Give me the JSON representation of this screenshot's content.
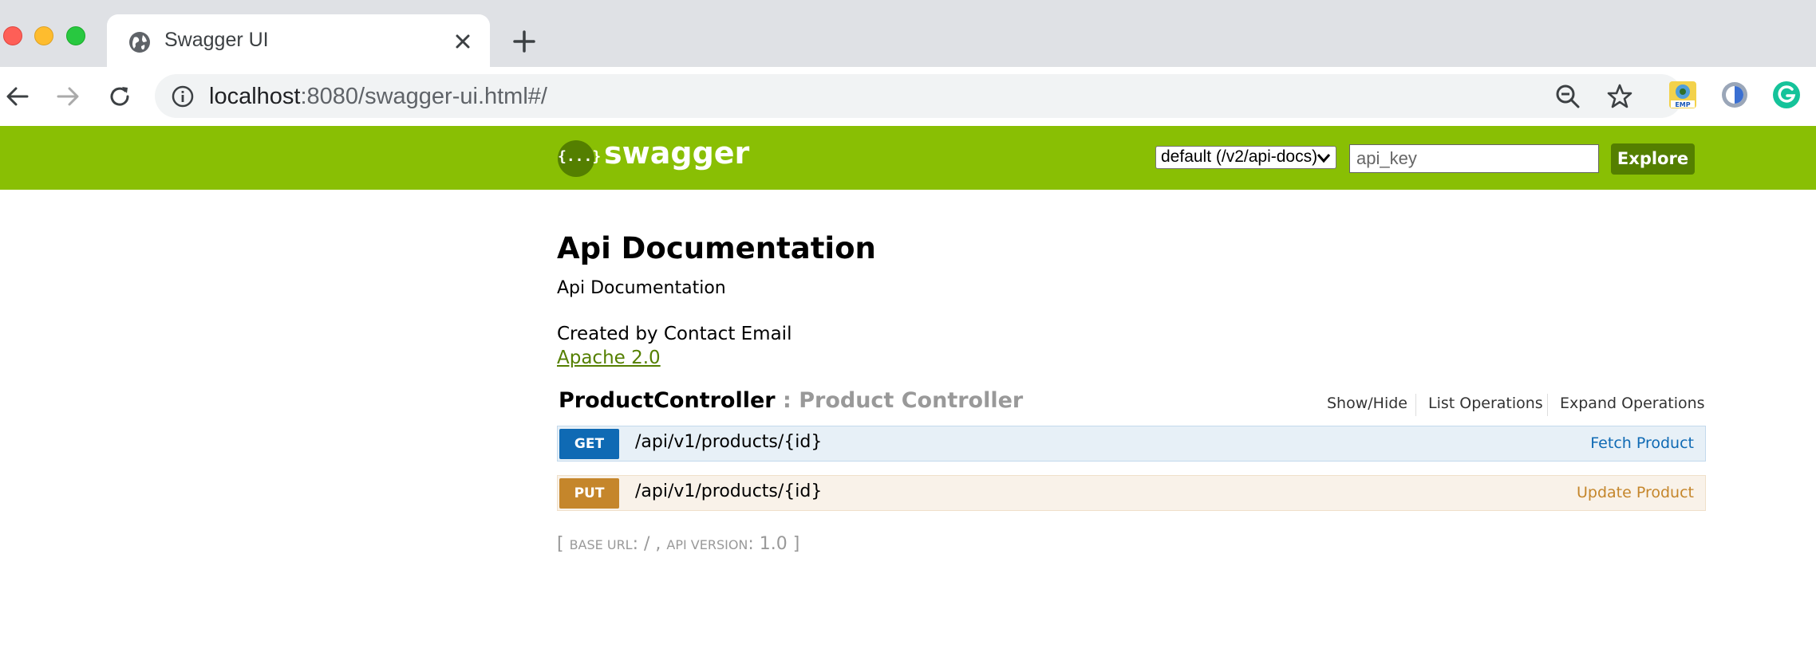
{
  "browser": {
    "tab_title": "Swagger UI",
    "url_host": "localhost",
    "url_rest": ":8080/swagger-ui.html#/",
    "extensions": [
      "emp-extension-icon",
      "shield-extension-icon",
      "grammarly-icon"
    ]
  },
  "swagger": {
    "brand": "swagger",
    "logo_glyph": "{...}",
    "spec_select": "default (/v2/api-docs)",
    "api_key_placeholder": "api_key",
    "explore_label": "Explore",
    "colors": {
      "header_bg": "#89bf04",
      "explore_bg": "#547f00",
      "get": "#0f6ab4",
      "put": "#c5862b"
    }
  },
  "info": {
    "title": "Api Documentation",
    "description": "Api Documentation",
    "contact": "Created by Contact Email",
    "license": "Apache 2.0"
  },
  "resource": {
    "name": "ProductController",
    "separator": " : ",
    "description": "Product Controller",
    "options": [
      "Show/Hide",
      "List Operations",
      "Expand Operations"
    ]
  },
  "operations": [
    {
      "method": "GET",
      "path": "/api/v1/products/{id}",
      "summary": "Fetch Product"
    },
    {
      "method": "PUT",
      "path": "/api/v1/products/{id}",
      "summary": "Update Product"
    }
  ],
  "footer": {
    "open": "[ ",
    "base_url_label": "base url",
    "base_url_value": ": / , ",
    "api_version_label": "api version",
    "api_version_value": ": 1.0 ]"
  }
}
